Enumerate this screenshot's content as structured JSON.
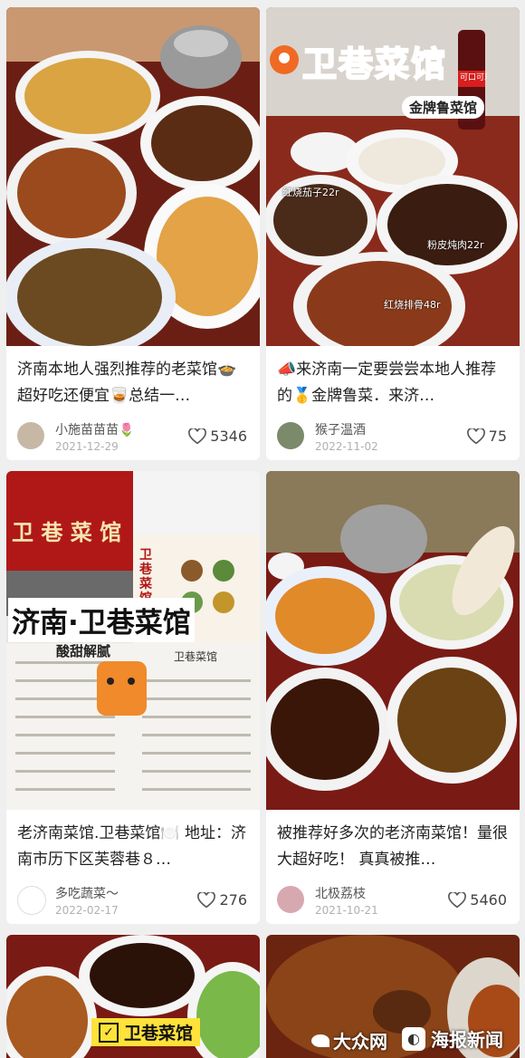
{
  "feed": {
    "cards": [
      {
        "title": "济南本地人强烈推荐的老菜馆🍲超好吃还便宜🥃总结一…",
        "author": "小施苗苗苗🌷",
        "date": "2021-12-29",
        "likes": "5346"
      },
      {
        "title": "📣来济南一定要尝尝本地人推荐的🥇金牌鲁菜．来济…",
        "author": "猴子温酒",
        "date": "2022-11-02",
        "likes": "75",
        "image_text": {
          "restaurant": "卫巷菜馆",
          "badge": "金牌鲁菜馆",
          "dish1": "红烧茄子22r",
          "dish2": "粉皮炖肉22r",
          "dish3": "红烧排骨48r",
          "cola": "可口可乐"
        }
      },
      {
        "title": "老济南菜馆.卫巷菜馆🍽️ 地址：济南市历下区芙蓉巷８…",
        "author": "多吃蔬菜～",
        "date": "2022-02-17",
        "likes": "276",
        "image_text": {
          "banner": "济南·卫巷菜馆",
          "storefront": "卫 巷 菜 馆",
          "menu_side": "卫巷菜馆",
          "menu_title": "卫巷菜馆",
          "menu_sub": "酸甜解腻"
        }
      },
      {
        "title": "被推荐好多次的老济南菜馆！量很大超好吃！ 真真被推…",
        "author": "北极荔枝",
        "date": "2021-10-21",
        "likes": "5460"
      },
      {
        "image_text": {
          "badge": "卫巷菜馆"
        }
      },
      {
        "image_text": {
          "watermark1": "大众网",
          "watermark2": "海报新闻"
        }
      }
    ]
  },
  "colors": {
    "background": "#efefef",
    "card": "#ffffff",
    "title_text": "#222222",
    "meta_text": "#b0b0b0",
    "brand_red": "#d62b2b"
  }
}
